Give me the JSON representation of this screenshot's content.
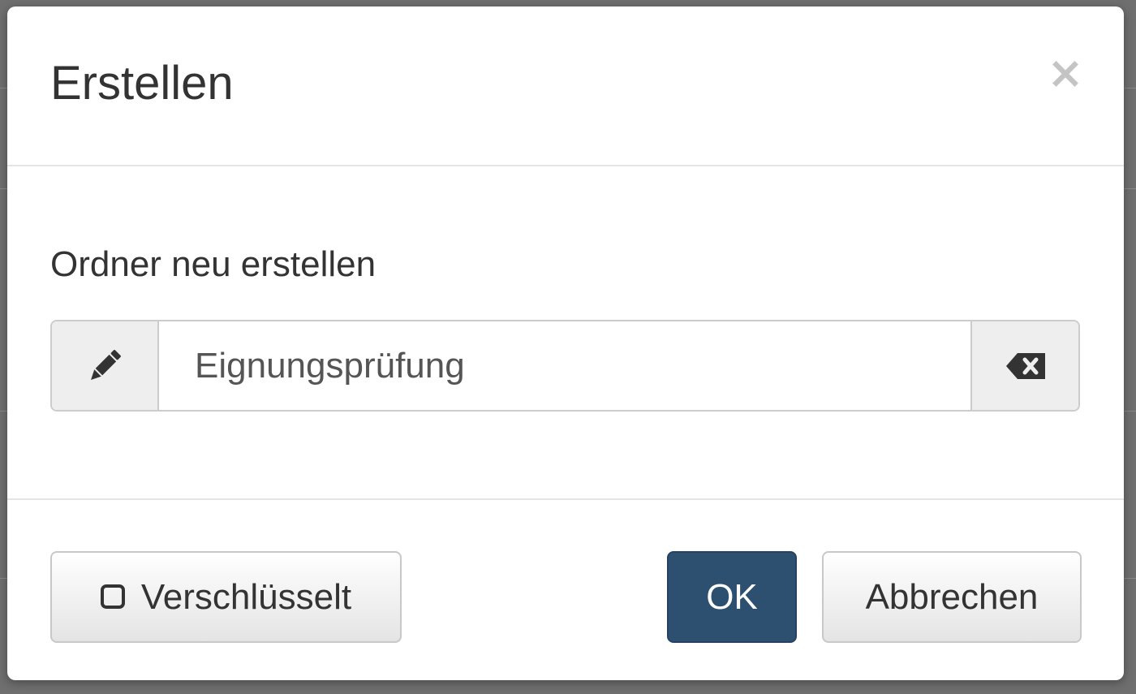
{
  "dialog": {
    "title": "Erstellen",
    "close_symbol": "×"
  },
  "form": {
    "label": "Ordner neu erstellen",
    "folder_name_value": "Eignungsprüfung",
    "left_icon": "pencil-icon",
    "right_icon": "backspace-clear-icon"
  },
  "footer": {
    "encrypted_label": "Verschlüsselt",
    "encrypted_checked": false,
    "ok_label": "OK",
    "cancel_label": "Abbrechen"
  },
  "colors": {
    "primary": "#2e5070",
    "overlay": "#6f6f6f",
    "text": "#333333"
  }
}
